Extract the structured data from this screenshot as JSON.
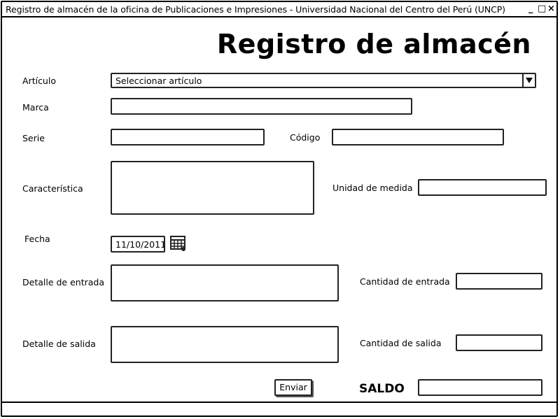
{
  "window": {
    "title": "Registro de almacén de la oficina de Publicaciones e Impresiones - Universidad Nacional del Centro del Perú (UNCP)",
    "controls": {
      "minimize": "_",
      "restore": "□",
      "close": "×"
    }
  },
  "page": {
    "heading": "Registro de almacén"
  },
  "form": {
    "articulo": {
      "label": "Artículo",
      "value": "Seleccionar artículo"
    },
    "marca": {
      "label": "Marca",
      "value": ""
    },
    "serie": {
      "label": "Serie",
      "value": ""
    },
    "codigo": {
      "label": "Código",
      "value": ""
    },
    "caracteristica": {
      "label": "Característica",
      "value": ""
    },
    "unidad_medida": {
      "label": "Unidad de medida",
      "value": ""
    },
    "fecha": {
      "label": "Fecha",
      "value": "11/10/2011"
    },
    "detalle_entrada": {
      "label": "Detalle de entrada",
      "value": ""
    },
    "cantidad_entrada": {
      "label": "Cantidad de entrada",
      "value": ""
    },
    "detalle_salida": {
      "label": "Detalle de salida",
      "value": ""
    },
    "cantidad_salida": {
      "label": "Cantidad de salida",
      "value": ""
    },
    "saldo": {
      "label": "SALDO",
      "value": ""
    },
    "submit_label": "Enviar"
  },
  "icons": {
    "calendar": "calendar-icon",
    "dropdown": "chevron-down-icon"
  }
}
